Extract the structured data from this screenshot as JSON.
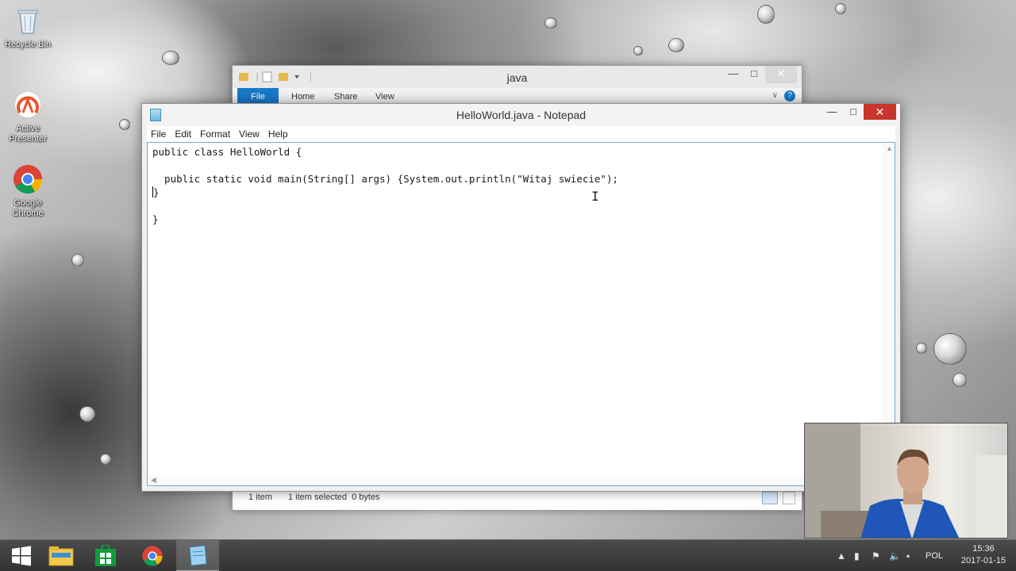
{
  "desktop": {
    "icons": [
      {
        "label": "Recycle Bin",
        "icon": "recycle-bin-icon"
      },
      {
        "label": "Active Presenter",
        "icon": "active-presenter-icon"
      },
      {
        "label": "Google Chrome",
        "icon": "chrome-icon"
      }
    ]
  },
  "explorer": {
    "title": "java",
    "tabs": [
      "File",
      "Home",
      "Share",
      "View"
    ],
    "status": {
      "items": "1 item",
      "selected": "1 item selected  0 bytes"
    },
    "file_tab_color": "#1979ca"
  },
  "notepad": {
    "title": "HelloWorld.java - Notepad",
    "menu": [
      "File",
      "Edit",
      "Format",
      "View",
      "Help"
    ],
    "code_lines": [
      "public class HelloWorld {",
      "",
      "  public static void main(String[] args) {System.out.println(\"Witaj swiecie\");",
      "}",
      "",
      "}"
    ],
    "close_color": "#c7352c"
  },
  "taskbar": {
    "apps": [
      "start-icon",
      "file-explorer-icon",
      "store-icon",
      "chrome-icon",
      "notepad-icon"
    ],
    "language": "POL",
    "time": "15:36",
    "date": "2017-01-15"
  }
}
